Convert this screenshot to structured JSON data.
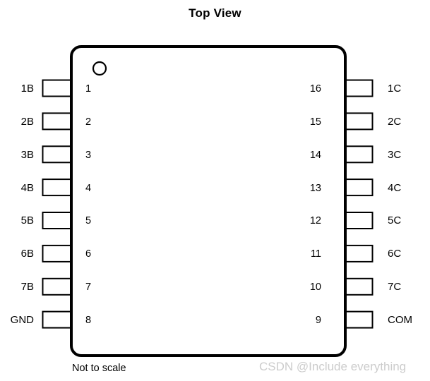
{
  "title": "Top View",
  "note": "Not to scale",
  "watermark": "CSDN @Include everything",
  "colors": {
    "outline": "#000000",
    "background": "#ffffff",
    "text": "#000000",
    "watermark": "#cccccc"
  },
  "package": {
    "orientation": "top-view",
    "pin_count": 16,
    "pin1_marker": "circle",
    "body_corner_radius": 14
  },
  "pins": {
    "left": [
      {
        "number": "1",
        "label": "1B"
      },
      {
        "number": "2",
        "label": "2B"
      },
      {
        "number": "3",
        "label": "3B"
      },
      {
        "number": "4",
        "label": "4B"
      },
      {
        "number": "5",
        "label": "5B"
      },
      {
        "number": "6",
        "label": "6B"
      },
      {
        "number": "7",
        "label": "7B"
      },
      {
        "number": "8",
        "label": "GND"
      }
    ],
    "right": [
      {
        "number": "16",
        "label": "1C"
      },
      {
        "number": "15",
        "label": "2C"
      },
      {
        "number": "14",
        "label": "3C"
      },
      {
        "number": "13",
        "label": "4C"
      },
      {
        "number": "12",
        "label": "5C"
      },
      {
        "number": "11",
        "label": "6C"
      },
      {
        "number": "10",
        "label": "7C"
      },
      {
        "number": "9",
        "label": "COM"
      }
    ]
  }
}
